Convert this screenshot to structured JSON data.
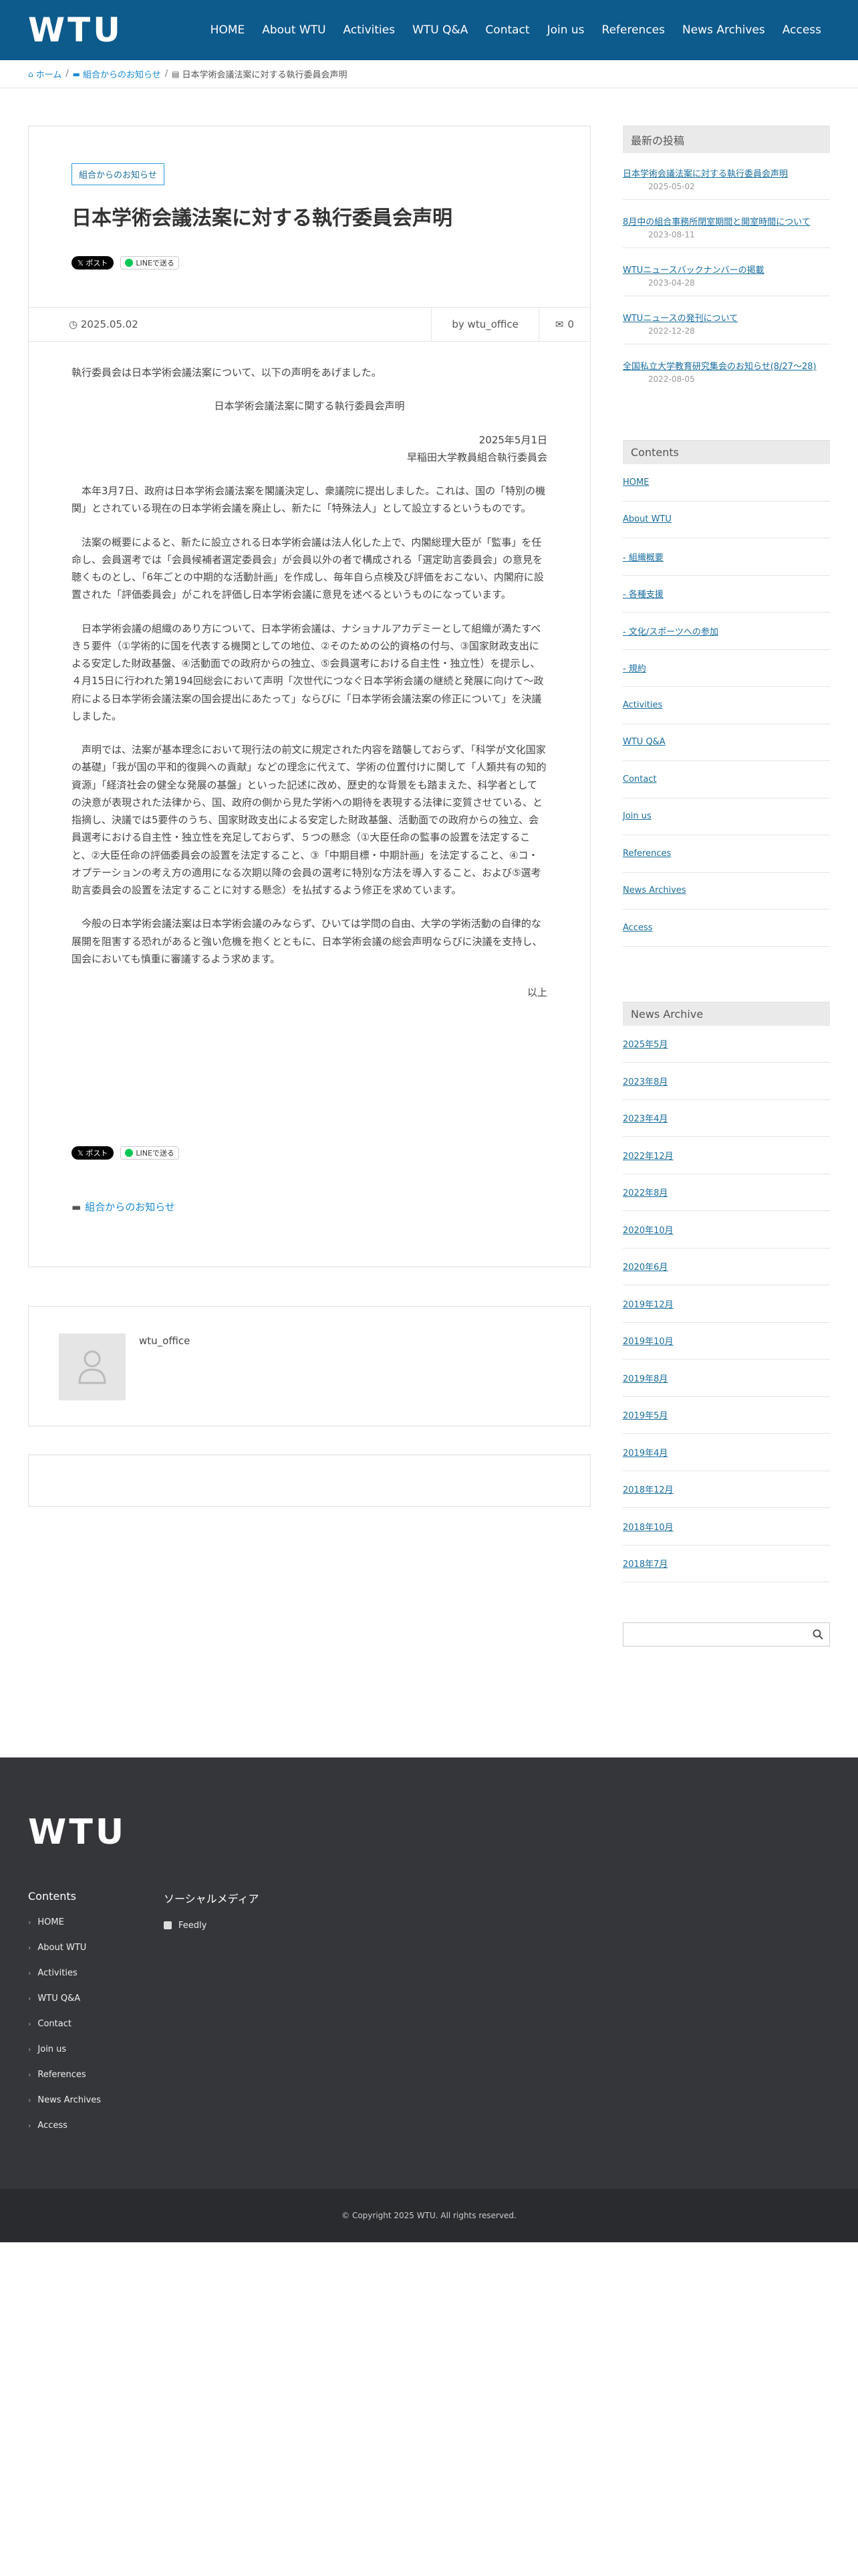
{
  "header": {
    "logo": "WTU",
    "nav": [
      "HOME",
      "About WTU",
      "Activities",
      "WTU Q&A",
      "Contact",
      "Join us",
      "References",
      "News Archives",
      "Access"
    ]
  },
  "breadcrumb": {
    "home": "ホーム",
    "category": "組合からのお知らせ",
    "current": "日本学術会議法案に対する執行委員会声明"
  },
  "post": {
    "category": "組合からのお知らせ",
    "title": "日本学術会議法案に対する執行委員会声明",
    "share_x": "𝕏 ポスト",
    "share_line": "LINEで送る",
    "date": "2025.05.02",
    "author_label": "by wtu_office",
    "comments": "0",
    "p_intro": "執行委員会は日本学術会議法案について、以下の声明をあげました。",
    "p_heading": "日本学術会議法案に関する執行委員会声明",
    "p_date": "2025年5月1日",
    "p_org": "早稲田大学教員組合執行委員会",
    "p1": "本年3月7日、政府は日本学術会議法案を閣議決定し、衆議院に提出しました。これは、国の「特別の機関」とされている現在の日本学術会議を廃止し、新たに「特殊法人」として設立するというものです。",
    "p2": "法案の概要によると、新たに設立される日本学術会議は法人化した上で、内閣総理大臣が「監事」を任命し、会員選考では「会員候補者選定委員会」が会員以外の者で構成される「選定助言委員会」の意見を聴くものとし、「6年ごとの中期的な活動計画」を作成し、毎年自ら点検及び評価をおこない、内閣府に設置された「評価委員会」がこれを評価し日本学術会議に意見を述べるというものになっています。",
    "p3": "日本学術会議の組織のあり方について、日本学術会議は、ナショナルアカデミーとして組織が満たすべき５要件（①学術的に国を代表する機関としての地位、②そのための公的資格の付与、③国家財政支出による安定した財政基盤、④活動面での政府からの独立、⑤会員選考における自主性・独立性）を提示し、４月15日に行われた第194回総会において声明「次世代につなぐ日本学術会議の継続と発展に向けて〜政府による日本学術会議法案の国会提出にあたって」ならびに「日本学術会議法案の修正について」を決議しました。",
    "p4": "声明では、法案が基本理念において現行法の前文に規定された内容を踏襲しておらず、「科学が文化国家の基礎」「我が国の平和的復興への貢献」などの理念に代えて、学術の位置付けに関して「人類共有の知的資源」「経済社会の健全な発展の基盤」といった記述に改め、歴史的な背景をも踏まえた、科学者としての決意が表現された法律から、国、政府の側から見た学術への期待を表現する法律に変質させている、と指摘し、決議では5要件のうち、国家財政支出による安定した財政基盤、活動面での政府からの独立、会員選考における自主性・独立性を充足しておらず、５つの懸念（①大臣任命の監事の設置を法定すること、②大臣任命の評価委員会の設置を法定すること、③「中期目標・中期計画」を法定すること、④コ・オプテーションの考え方の適用になる次期以降の会員の選考に特別な方法を導入すること、および⑤選考助言委員会の設置を法定することに対する懸念）を払拭するよう修正を求めています。",
    "p5": "今般の日本学術会議法案は日本学術会議のみならず、ひいては学問の自由、大学の学術活動の自律的な展開を阻害する恐れがあると強い危機を抱くとともに、日本学術会議の総会声明ならびに決議を支持し、国会においても慎重に審議するよう求めます。",
    "p_end": "以上",
    "footer_category": "組合からのお知らせ"
  },
  "author_box": {
    "name": "wtu_office"
  },
  "sidebar": {
    "recent_title": "最新の投稿",
    "recent": [
      {
        "title": "日本学術会議法案に対する執行委員会声明",
        "date": "2025-05-02"
      },
      {
        "title": "8月中の組合事務所閉室期間と開室時間について",
        "date": "2023-08-11"
      },
      {
        "title": "WTUニュースバックナンバーの掲載",
        "date": "2023-04-28"
      },
      {
        "title": "WTUニュースの発刊について",
        "date": "2022-12-28"
      },
      {
        "title": "全国私立大学教育研究集会のお知らせ(8/27〜28)",
        "date": "2022-08-05"
      }
    ],
    "contents_title": "Contents",
    "contents": [
      "HOME",
      "About WTU",
      "- 組織概要",
      "- 各種支援",
      "- 文化/スポーツへの参加",
      "- 規約",
      "Activities",
      "WTU Q&A",
      "Contact",
      "Join us",
      "References",
      "News Archives",
      "Access"
    ],
    "archive_title": "News Archive",
    "archives": [
      "2025年5月",
      "2023年8月",
      "2023年4月",
      "2022年12月",
      "2022年8月",
      "2020年10月",
      "2020年6月",
      "2019年12月",
      "2019年10月",
      "2019年8月",
      "2019年5月",
      "2019年4月",
      "2018年12月",
      "2018年10月",
      "2018年7月"
    ],
    "search_placeholder": ""
  },
  "footer": {
    "logo": "WTU",
    "contents_title": "Contents",
    "links": [
      "HOME",
      "About WTU",
      "Activities",
      "WTU Q&A",
      "Contact",
      "Join us",
      "References",
      "News Archives",
      "Access"
    ],
    "social_title": "ソーシャルメディア",
    "social": [
      "Feedly"
    ],
    "copyright": "© Copyright 2025 WTU. All rights reserved."
  }
}
